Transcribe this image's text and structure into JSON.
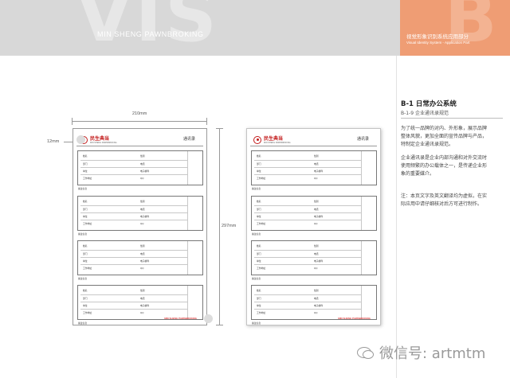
{
  "header": {
    "big_text": "VIS",
    "company": "MIN SHENG PAWNBROKING",
    "accent_letter": "B",
    "accent_title_cn": "视觉形象识别系统应用部分",
    "accent_title_en": "Visual Identity System - Application Part",
    "accent_color": "#ef9d74"
  },
  "section": {
    "title": "B-1 日常办公系统",
    "subtitle": "B-1-9 企业通讯录规范",
    "paragraphs": [
      "为了统一品牌的对内、外形象，展示品牌整体风貌，更加全面的宣传品牌与产品，特制定企业通讯录规范。",
      "企业通讯录是企业内部沟通和对外交流时使用频繁的办公载体之一，是传递企业形象的重要媒介。",
      "注：本页文字及英文翻译均为虚拟，在实际应用中请仔细核对后方可进行制作。"
    ]
  },
  "dimensions": {
    "width": "210mm",
    "height": "297mm",
    "margin": "12mm"
  },
  "document": {
    "logo_cn": "民生典当",
    "logo_en": "MIN SHENG PAWNBROKING",
    "title": "通讯录",
    "fields_left": [
      "姓名",
      "部门",
      "单位",
      "工作地址"
    ],
    "fields_right": [
      "性别",
      "电话",
      "电子邮件",
      "QQ"
    ],
    "footer_label": "备注信息"
  },
  "watermark": {
    "text": "微信号: artmtm"
  }
}
